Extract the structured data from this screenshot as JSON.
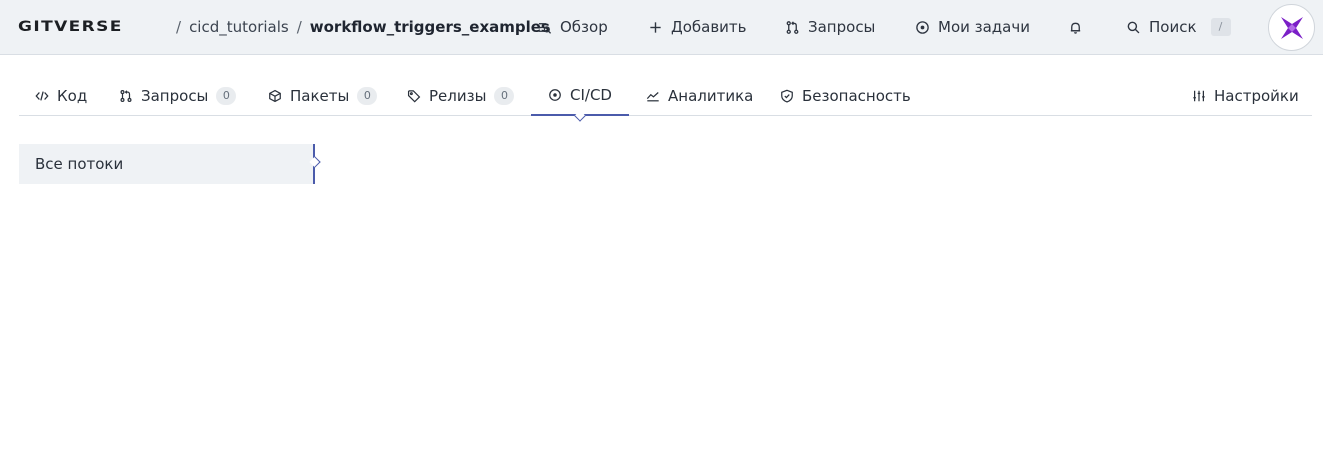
{
  "header": {
    "logo": "GITVERSE",
    "separator": "/",
    "owner": "cicd_tutorials",
    "repo": "workflow_triggers_examples",
    "nav": {
      "overview": "Обзор",
      "add": "Добавить",
      "requests": "Запросы",
      "tasks": "Мои задачи",
      "search": "Поиск",
      "search_shortcut": "/"
    }
  },
  "tabs": {
    "code": "Код",
    "requests": "Запросы",
    "requests_count": "0",
    "packages": "Пакеты",
    "packages_count": "0",
    "releases": "Релизы",
    "releases_count": "0",
    "cicd": "CI/CD",
    "analytics": "Аналитика",
    "security": "Безопасность",
    "settings": "Настройки"
  },
  "sidebar": {
    "all_workflows": "Все потоки"
  },
  "colors": {
    "accent": "#4b5bab",
    "topbar_bg": "#eff2f5",
    "avatar": "#7b1fc7"
  }
}
